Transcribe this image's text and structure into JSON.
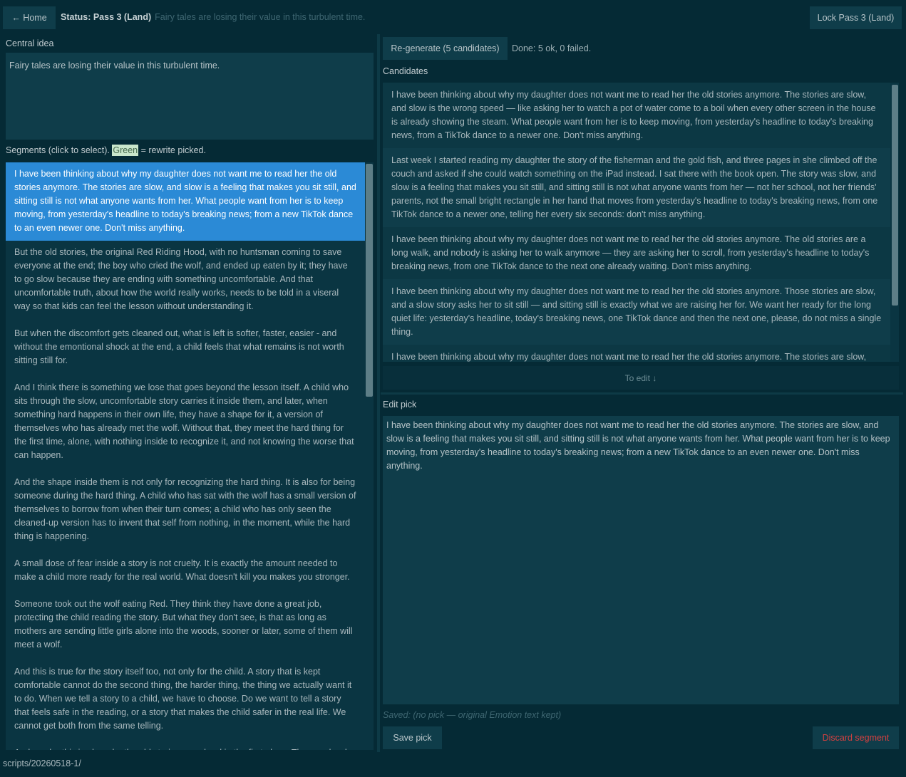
{
  "topbar": {
    "home_label": "← Home",
    "status_label": "Status: Pass 3 (Land)",
    "central_idea_preview": "Fairy tales are losing their value in this turbulent time.",
    "lock_label": "Lock Pass 3 (Land)"
  },
  "central": {
    "label": "Central idea",
    "value": "Fairy tales are losing their value in this turbulent time."
  },
  "segments": {
    "label_prefix": "Segments (click to select).",
    "label_green": "Green",
    "label_suffix": "= rewrite picked.",
    "items": [
      "I have been thinking about why my daughter does not want me to read her the old stories anymore. The stories are slow, and slow is a feeling that makes you sit still, and sitting still is not what anyone wants from her. What people want from her is to keep moving, from yesterday's headline to today's breaking news; from  a new TikTok dance to an even newer one. Don't miss anything.",
      "But the old stories, the original Red Riding Hood, with no huntsman coming to save everyone at the end; the boy who cried the wolf, and ended up eaten by it; they have to go slow because they are ending with something uncomfortable. And that uncomfortable truth, about how the world really works, needs to be told in  a viseral way so that kids can feel the lesson without understanding it.",
      "But when the discomfort gets cleaned out, what is left is softer, faster, easier - and without the emontional shock at the end, a child feels that what remains is not worth sitting still for.",
      "And I think there is something we lose that goes beyond the lesson itself. A child who sits through the slow, uncomfortable story carries it inside them, and later, when something hard happens in their own life, they have a shape for it, a version of themselves who has already met the wolf. Without that, they meet the hard thing for the first time, alone, with nothing inside to recognize it, and not knowing the worse that can happen.",
      "And the shape inside them is not only for recognizing the hard thing. It is also for being someone during the hard thing. A child who has sat with the wolf has a small version of themselves to borrow from when their turn comes; a child who has only seen the cleaned-up version has to invent that self from nothing, in the moment, while the hard thing is happening.",
      "A small dose of fear inside a story is not cruelty. It is exactly the amount needed to make a child more ready for the real world. What doesn't kill you makes you stronger.",
      "Someone took out the wolf eating Red. They think they have done a great job, protecting the child reading the story. But what they don't see, is that as long as mothers are sending little girls alone into the woods, sooner or later, some of them will meet a wolf.",
      "And this is true for the story itself too, not only for the child. A story that is kept comfortable cannot do the second thing, the harder thing, the thing we actually want it to do. When we tell a story to a child, we have to choose. Do we want to tell a story that feels safe in the reading, or a story that makes the child safer in the real life. We cannot get both from the same telling.",
      "And maybe this is also why the old stories were hard in the first place. The people who made them were not cruel. They were living close enough to death that they knew a child who is treated as fragile stays fragile, and a child who is given the wolf early grows the"
    ]
  },
  "regenerate": {
    "label": "Re-generate (5 candidates)",
    "done_text": "Done: 5 ok, 0 failed."
  },
  "candidates": {
    "label": "Candidates",
    "items": [
      "I have been thinking about why my daughter does not want me to read her the old stories anymore. The stories are slow, and slow is the wrong speed — like asking her to watch a pot of water come to a boil when every other screen in the house is already showing the steam. What people want from her is to keep moving, from yesterday's headline to today's breaking news, from a TikTok dance to a newer one. Don't miss anything.",
      "Last week I started reading my daughter the story of the fisherman and the gold fish, and three pages in she climbed off the couch and asked if she could watch something on the iPad instead. I sat there with the book open. The story was slow, and slow is a feeling that makes you sit still, and sitting still is not what anyone wants from her — not her school, not her friends' parents, not the small bright rectangle in her hand that moves from yesterday's headline to today's breaking news, from one TikTok dance to a newer one, telling her every six seconds: don't miss anything.",
      "I have been thinking about why my daughter does not want me to read her the old stories anymore. The old stories are a long walk, and nobody is asking her to walk anymore — they are asking her to scroll, from yesterday's headline to today's breaking news, from one TikTok dance to the next one already waiting. Don't miss anything.",
      "I have been thinking about why my daughter does not want me to read her the old stories anymore. Those stories are slow, and a slow story asks her to sit still — and sitting still is exactly what we are raising her for. We want her ready for the long quiet life: yesterday's headline, today's breaking news, one TikTok dance and then the next one, please, do not miss a single thing.",
      "I have been thinking about why my daughter does not want me to read her the old stories anymore. The stories are slow, and slow is a feeling that makes you sit still, and sitting still is not what anyone wants from her. What people want from her is to keep moving."
    ],
    "to_edit_label": "To edit ↓"
  },
  "edit": {
    "label": "Edit pick",
    "value": "I have been thinking about why my daughter does not want me to read her the old stories anymore. The stories are slow, and slow is a feeling that makes you sit still, and sitting still is not what anyone wants from her. What people want from her is to keep moving, from yesterday's headline to today's breaking news; from  a new TikTok dance to an even newer one. Don't miss anything.",
    "saved_text": "Saved: (no pick — original Emotion text kept)",
    "save_label": "Save pick",
    "discard_label": "Discard segment"
  },
  "footer": {
    "path": "scripts/20260518-1/"
  },
  "colors": {
    "background": "#052a35",
    "panel": "#0f3d4a",
    "selected": "#2b8ad6",
    "danger": "#d24040",
    "picked": "#c9e6cb"
  }
}
